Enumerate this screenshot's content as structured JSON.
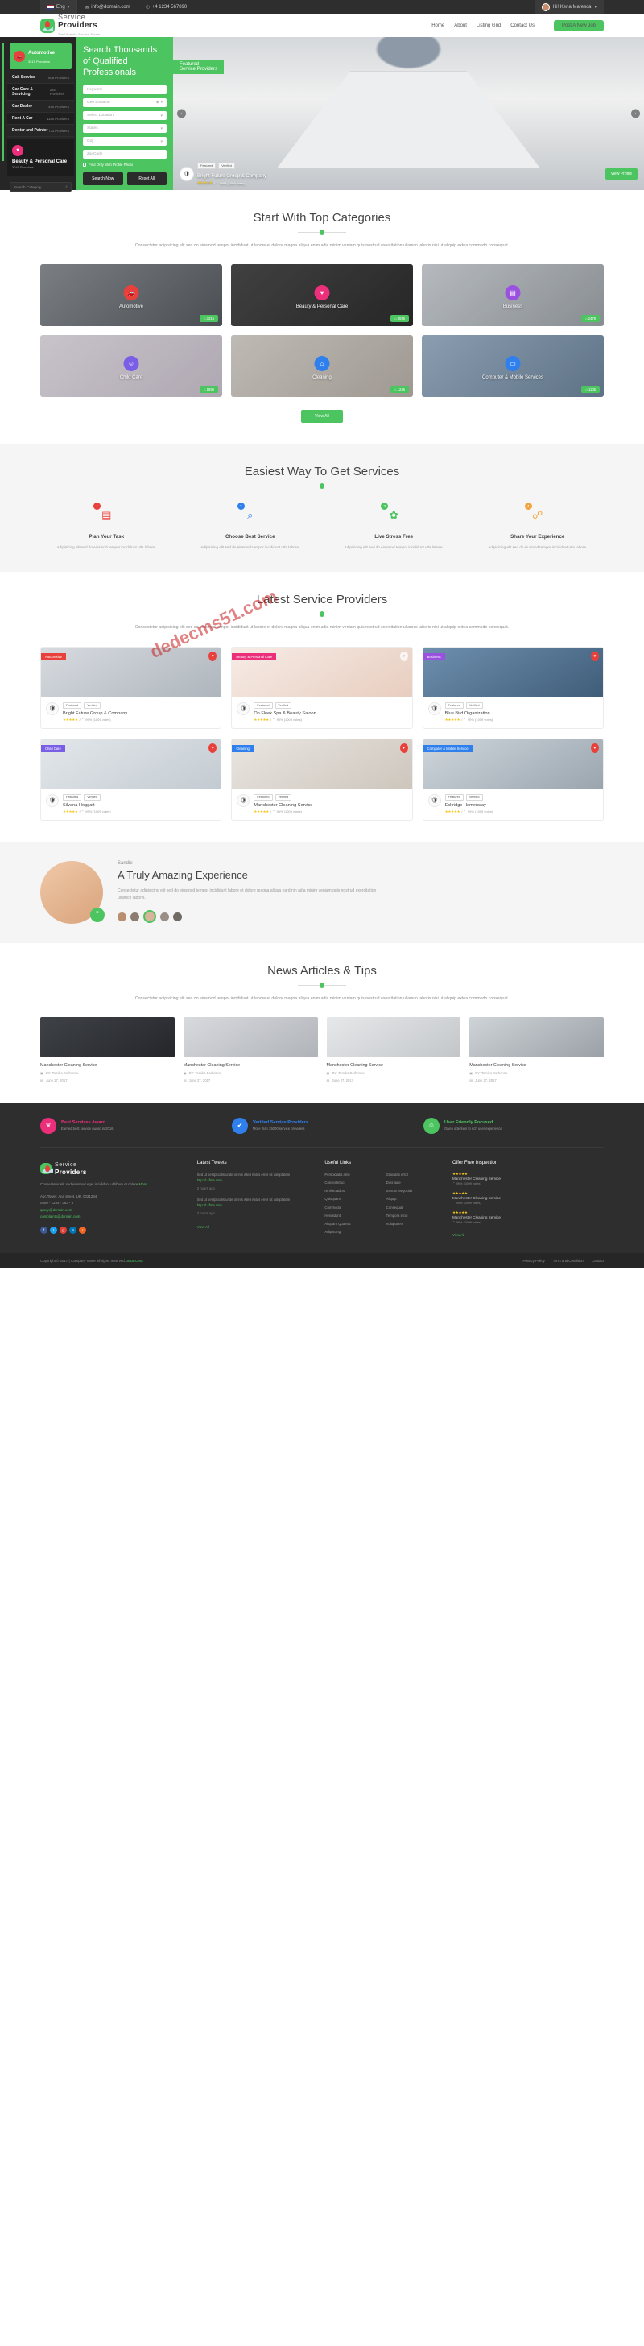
{
  "topbar": {
    "lang": "Eng",
    "email": "info@domain.com",
    "phone": "+4 1234 567890",
    "user_greeting": "Hi! Kena Maresca",
    "icons": {
      "flag": "us-flag-icon",
      "mail": "mail-icon",
      "phone": "phone-icon",
      "caret": "chevron-down-icon"
    }
  },
  "header": {
    "logo_line1": "Service",
    "logo_line2": "Providers",
    "logo_tagline": "The Ultimate Service Finder",
    "nav": [
      "Home",
      "About",
      "Listing Grid",
      "Contact Us"
    ],
    "cta": "Post A New Job"
  },
  "hero": {
    "title": "Search Thousands of Qualified Professionals",
    "featured_label": "Featured",
    "featured_sub": "Service Providers",
    "fields": [
      {
        "placeholder": "Keyword",
        "icon": ""
      },
      {
        "placeholder": "Geo Location",
        "icon": "map-pin-icon"
      },
      {
        "placeholder": "Select Location",
        "icon": "chevron-down-icon"
      },
      {
        "placeholder": "States",
        "icon": "chevron-down-icon"
      },
      {
        "placeholder": "City",
        "icon": "chevron-down-icon"
      },
      {
        "placeholder": "Zip Code",
        "icon": ""
      }
    ],
    "checkbox_label": "Find Only With Profile Photo",
    "search_button": "Search Now",
    "reset_button": "Reset All",
    "sidebar": {
      "main_category": {
        "name": "Automotive",
        "providers": "3215 Providers",
        "icon": "car-icon"
      },
      "items": [
        {
          "name": "Cab Service",
          "providers": "609 Providers"
        },
        {
          "name": "Car Care & Servicing",
          "providers": "225 Providers"
        },
        {
          "name": "Car Dealer",
          "providers": "490 Providers"
        },
        {
          "name": "Rent A Car",
          "providers": "1180 Providers"
        },
        {
          "name": "Denter and Painter",
          "providers": "711 Providers"
        }
      ],
      "block_category": {
        "name": "Beauty & Personal Care",
        "providers": "3045 Providers",
        "icon": "heart-icon"
      },
      "search_placeholder": "Search Category"
    },
    "slide_provider": {
      "tags": [
        "Featured",
        "Verified"
      ],
      "name": "Bright Future Group & Company",
      "rating_text": "99% (1009 votes)",
      "stars": 5,
      "button": "View Profile"
    }
  },
  "categories_section": {
    "title": "Start With Top Categories",
    "desc": "Consectetur adipisicing elit sed do eiusmod tempor incididunt ut labore et dolore magna aliqua enim adia minim veniam quis nostrud exercitation ullamco laboris nisi ut aliquip extea commodo consequat.",
    "view_all": "View All",
    "items": [
      {
        "name": "Automotive",
        "count": "3215",
        "icon": "car-icon",
        "color": "#e8413c",
        "bg1": "#8c9196",
        "bg2": "#55595e"
      },
      {
        "name": "Beauty & Personal Care",
        "count": "3045",
        "icon": "heart-icon",
        "color": "#ec2f7a",
        "bg1": "#4a4a4a",
        "bg2": "#2c2c2c"
      },
      {
        "name": "Business",
        "count": "2478",
        "icon": "briefcase-icon",
        "color": "#9b51e0",
        "bg1": "#cfd4d8",
        "bg2": "#9ba1a6"
      },
      {
        "name": "Child Care",
        "count": "1890",
        "icon": "child-icon",
        "color": "#7b5ee6",
        "bg1": "#e4dfe6",
        "bg2": "#c7bfcb"
      },
      {
        "name": "Cleaning",
        "count": "1245",
        "icon": "broom-icon",
        "color": "#2f80ed",
        "bg1": "#d9d4ce",
        "bg2": "#b5aea6"
      },
      {
        "name": "Computer & Mobile Services",
        "count": "1106",
        "icon": "laptop-icon",
        "color": "#2f80ed",
        "bg1": "#9fb4c9",
        "bg2": "#6b8299"
      }
    ]
  },
  "steps_section": {
    "title": "Easiest Way To Get Services",
    "items": [
      {
        "num": "1",
        "title": "Plan Your Task",
        "desc": "Adipisicing elit sed do eiusmod tempor incididunt utla labore.",
        "icon": "clipboard-icon",
        "color": "#e8413c"
      },
      {
        "num": "2",
        "title": "Choose Best Service",
        "desc": "Adipisicing elit sed do eiusmod tempor incididunt utla labore.",
        "icon": "search-user-icon",
        "color": "#2f80ed"
      },
      {
        "num": "3",
        "title": "Live Stress Free",
        "desc": "Adipisicing elit sed do eiusmod tempor incididunt utla labore.",
        "icon": "gear-icon",
        "color": "#4cc45f"
      },
      {
        "num": "4",
        "title": "Share Your Experience",
        "desc": "Adipisicing elit sed do eiusmod tempor incididunt utla labore.",
        "icon": "share-icon",
        "color": "#f2a33c"
      }
    ]
  },
  "providers_section": {
    "title": "Latest Service Providers",
    "desc": "Consectetur adipisicing elit sed do eiusmod tempor incididunt ut labore et dolore magna aliqua enim adia minim veniam quis nostrud exercitation ullamco laboris nisi ut aliquip extea commodo consequat.",
    "items": [
      {
        "tag": "Automotive",
        "tag_color": "#e8413c",
        "name": "Bright Future Group & Company",
        "tags": [
          "Featured",
          "Verified"
        ],
        "rating_text": "99% (1009 votes)",
        "heart": "filled",
        "bg1": "#d7dbe0",
        "bg2": "#aeb5bc"
      },
      {
        "tag": "Beauty & Personal Care",
        "tag_color": "#ec2f7a",
        "name": "On Fleek Spa & Beauty Saloon",
        "tags": [
          "Featured",
          "Verified"
        ],
        "rating_text": "99% (1009 votes)",
        "heart": "ghost",
        "bg1": "#f6ece6",
        "bg2": "#e8cdbf"
      },
      {
        "tag": "Business",
        "tag_color": "#9b51e0",
        "name": "Blue Bird Organization",
        "tags": [
          "Featured",
          "Verified"
        ],
        "rating_text": "99% (1009 votes)",
        "heart": "filled",
        "bg1": "#6e8fae",
        "bg2": "#3f5d79"
      },
      {
        "tag": "Child Care",
        "tag_color": "#7b5ee6",
        "name": "Silvana Hoggatt",
        "tags": [
          "Featured",
          "Verified"
        ],
        "rating_text": "99% (1009 votes)",
        "heart": "filled",
        "bg1": "#e3e7ea",
        "bg2": "#c3cbd2"
      },
      {
        "tag": "Cleaning",
        "tag_color": "#2f80ed",
        "name": "Manchester Cleaning Service",
        "tags": [
          "Featured",
          "Verified"
        ],
        "rating_text": "99% (1009 votes)",
        "heart": "filled",
        "bg1": "#e9e5e0",
        "bg2": "#cdc6bd"
      },
      {
        "tag": "Computer & Mobile Service",
        "tag_color": "#2f80ed",
        "name": "Eskridge Hemenway",
        "tags": [
          "Featured",
          "Verified"
        ],
        "rating_text": "99% (1009 votes)",
        "heart": "filled",
        "bg1": "#cfd6dc",
        "bg2": "#9aa5ae"
      }
    ]
  },
  "testimonial": {
    "name": "Sandie",
    "title": "A Truly Amazing Experience",
    "text": "Consectetur adipisicing elit sed do eiusmod tempor incididunt labore et dolore magna aliqua eardmin adia minim veniam quis nostrud exercitation ullamco laboris.",
    "quote_icon": "quote-icon"
  },
  "news_section": {
    "title": "News Articles & Tips",
    "desc": "Consectetur adipisicing elit sed do eiusmod tempor incididunt ut labore et dolore magna aliqua enim adia minim veniam quis nostrud exercitation ullamco laboris nisi ut aliquip extea commodo consequat.",
    "items": [
      {
        "title": "Manchester Cleaning Service",
        "author": "BY: Tamika Barbonne",
        "date": "June 27, 2017",
        "bg1": "#3f4247",
        "bg2": "#24262a"
      },
      {
        "title": "Manchester Cleaning Service",
        "author": "BY: Tamika Barbonne",
        "date": "June 27, 2017",
        "bg1": "#d8dade",
        "bg2": "#b0b3b8"
      },
      {
        "title": "Manchester Cleaning Service",
        "author": "BY: Tamika Barbonne",
        "date": "June 27, 2017",
        "bg1": "#e6e8ea",
        "bg2": "#c3c6c9"
      },
      {
        "title": "Manchester Cleaning Service",
        "author": "BY: Tamika Barbonne",
        "date": "June 27, 2017",
        "bg1": "#cfd4d8",
        "bg2": "#9aa0a6"
      }
    ]
  },
  "footer": {
    "awards": [
      {
        "title": "Best Services Award",
        "desc": "Earned best service award in 2016",
        "color": "#ec2f7a",
        "icon": "trophy-icon"
      },
      {
        "title": "Verified Service Providers",
        "desc": "More than 35000 service providers",
        "color": "#2f80ed",
        "icon": "check-shield-icon"
      },
      {
        "title": "User Friendly Focused",
        "desc": "Given attention to rich user experience",
        "color": "#4cc45f",
        "icon": "smile-icon"
      }
    ],
    "about": {
      "logo_line1": "Service",
      "logo_line2": "Providers",
      "text": "Consectetur elit sed eiusmod eget incididunt ut libero et dolore",
      "more_link": "More ...",
      "address": "Abc Tower, Apc street, UK, 0021234",
      "phone": "0800 - 1234 - 363 - 9",
      "email": "query@domain.com",
      "email2": "complaints@domain.com",
      "socials": [
        "facebook-icon",
        "twitter-icon",
        "google-plus-icon",
        "linkedin-icon",
        "rss-icon"
      ]
    },
    "tweets": {
      "heading": "Latest Tweets",
      "items": [
        {
          "text": "Sed ut perspiciatis unde omnis isted natus error sit voluptatem",
          "link": "http://t.cfma.com",
          "time": "2 hours ago"
        },
        {
          "text": "Sed ut perspiciatis unde omnis isted natus error sit voluptatem",
          "link": "http://t.cfma.com",
          "time": "3 hours ago"
        }
      ],
      "view_all": "View All"
    },
    "useful_links": {
      "heading": "Useful Links",
      "items": [
        "Perspiciatis ante",
        "Gravidas error",
        "Consectetuo",
        "Duis aute",
        "Nihil et adios",
        "Stetum Negociati",
        "Quisquam",
        "Aliquip",
        "Commodo ",
        "Consequat",
        "Hendidunt",
        "Tempora incid",
        "Aliquam Quaerat",
        "Voluptatem",
        "Adipiscing"
      ]
    },
    "offers": {
      "heading": "Offer Free Inspection",
      "items": [
        {
          "name": "Manchester Cleaning Service",
          "votes": "99% (1009 votes)"
        },
        {
          "name": "Manchester Cleaning Service",
          "votes": "99% (1009 votes)"
        },
        {
          "name": "Manchester Cleaning Service",
          "votes": "99% (1009 votes)"
        }
      ],
      "view_all": "View All"
    },
    "copyright": "Copyright © 2017 | Company name all rights reserved.",
    "copyright_link": "DEDECMS",
    "bottom_links": [
      "Privacy Policy",
      "Term and Condition",
      "Contact"
    ]
  }
}
